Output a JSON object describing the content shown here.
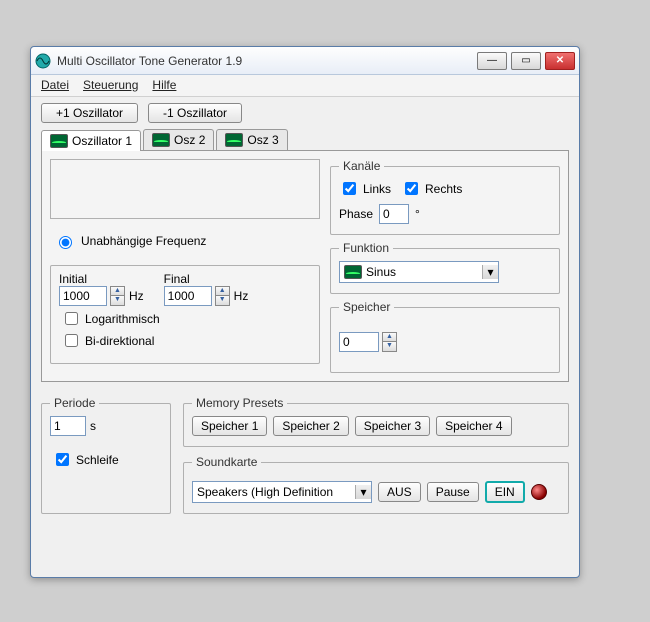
{
  "title": "Multi Oscillator Tone Generator 1.9",
  "menu": {
    "file": "Datei",
    "control": "Steuerung",
    "help": "Hilfe"
  },
  "buttons": {
    "add_osc": "+1 Oszillator",
    "remove_osc": "-1 Oszillator"
  },
  "tabs": [
    {
      "label": "Oszillator 1",
      "active": true
    },
    {
      "label": "Osz 2",
      "active": false
    },
    {
      "label": "Osz 3",
      "active": false
    }
  ],
  "freq": {
    "independent_label": "Unabhängige Frequenz",
    "initial_label": "Initial",
    "final_label": "Final",
    "initial": "1000",
    "final": "1000",
    "unit": "Hz",
    "logarithmic_label": "Logarithmisch",
    "bidirectional_label": "Bi-direktional",
    "logarithmic_checked": false,
    "bidirectional_checked": false
  },
  "channels": {
    "legend": "Kanäle",
    "links_label": "Links",
    "rechts_label": "Rechts",
    "links_checked": true,
    "rechts_checked": true,
    "phase_label": "Phase",
    "phase_value": "0",
    "phase_unit": "°"
  },
  "function": {
    "legend": "Funktion",
    "value": "Sinus"
  },
  "storage": {
    "legend": "Speicher",
    "value": "0"
  },
  "periode": {
    "legend": "Periode",
    "value": "1",
    "unit": "s",
    "loop_label": "Schleife",
    "loop_checked": true
  },
  "presets": {
    "legend": "Memory Presets",
    "items": [
      "Speicher 1",
      "Speicher 2",
      "Speicher 3",
      "Speicher 4"
    ]
  },
  "soundcard": {
    "legend": "Soundkarte",
    "value": "Speakers (High Definition"
  },
  "transport": {
    "off": "AUS",
    "pause": "Pause",
    "on": "EIN"
  }
}
